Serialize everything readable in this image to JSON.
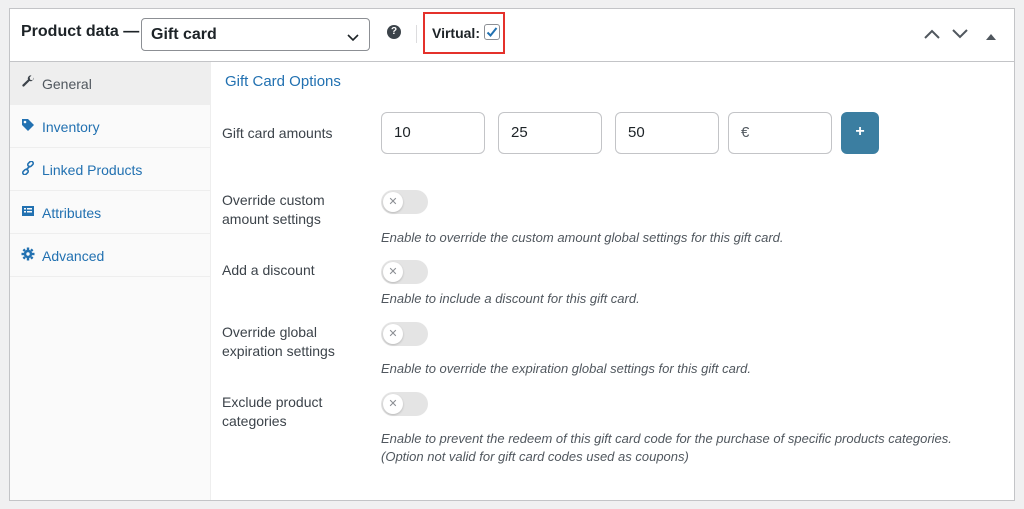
{
  "header": {
    "title": "Product data —",
    "product_type": "Gift card",
    "help": "?",
    "virtual_label": "Virtual:",
    "virtual_checked": true
  },
  "sidebar": {
    "items": [
      {
        "label": "General",
        "icon": "wrench-icon",
        "active": true
      },
      {
        "label": "Inventory",
        "icon": "tag-icon",
        "active": false
      },
      {
        "label": "Linked Products",
        "icon": "link-icon",
        "active": false
      },
      {
        "label": "Attributes",
        "icon": "list-icon",
        "active": false
      },
      {
        "label": "Advanced",
        "icon": "gear-icon",
        "active": false
      }
    ]
  },
  "main": {
    "section_title": "Gift Card Options",
    "amounts_label": "Gift card amounts",
    "amounts": [
      "10",
      "25",
      "50"
    ],
    "currency_placeholder": "€",
    "add_button": "+",
    "settings": [
      {
        "label_line1": "Override custom",
        "label_line2": "amount settings",
        "desc_line1": "Enable to override the custom amount global settings for this gift card.",
        "desc_line2": "",
        "enabled": false
      },
      {
        "label_line1": "Add a discount",
        "label_line2": "",
        "desc_line1": "Enable to include a discount for this gift card.",
        "desc_line2": "",
        "enabled": false
      },
      {
        "label_line1": "Override global",
        "label_line2": "expiration settings",
        "desc_line1": "Enable to override the expiration global settings for this gift card.",
        "desc_line2": "",
        "enabled": false
      },
      {
        "label_line1": "Exclude product",
        "label_line2": "categories",
        "desc_line1": "Enable to prevent the redeem of this gift card code for the purchase of specific products categories.",
        "desc_line2": "(Option not valid for gift card codes used as coupons)",
        "enabled": false
      }
    ]
  },
  "colors": {
    "accent": "#2271b1",
    "button": "#3b7ea1",
    "highlight_border": "#e4312b"
  }
}
